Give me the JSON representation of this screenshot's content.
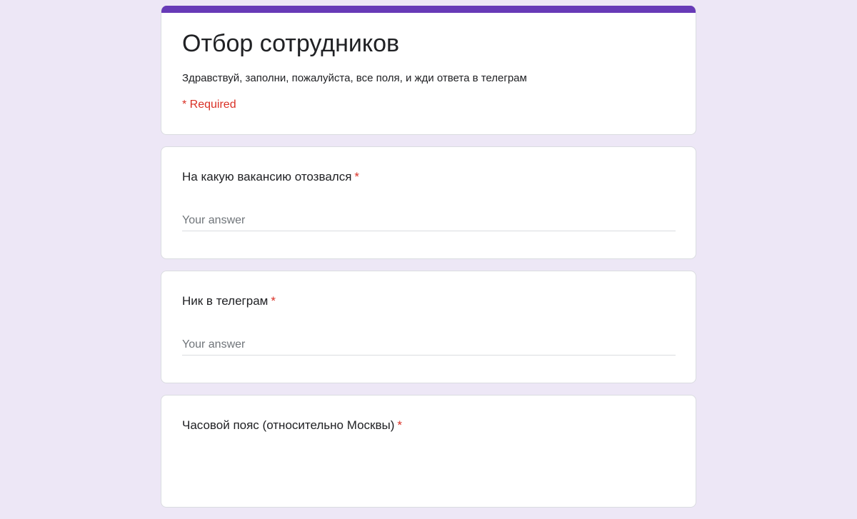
{
  "form": {
    "title": "Отбор сотрудников",
    "description": "Здравствуй, заполни, пожалуйста, все поля, и жди ответа в телеграм",
    "required_note": "* Required",
    "accent_color": "#673ab7",
    "background_color": "#ede7f6"
  },
  "questions": [
    {
      "label": "На какую вакансию отозвался",
      "required_mark": "*",
      "placeholder": "Your answer",
      "value": ""
    },
    {
      "label": "Ник в телеграм",
      "required_mark": "*",
      "placeholder": "Your answer",
      "value": ""
    },
    {
      "label": "Часовой пояс (относительно Москвы)",
      "required_mark": "*"
    }
  ]
}
